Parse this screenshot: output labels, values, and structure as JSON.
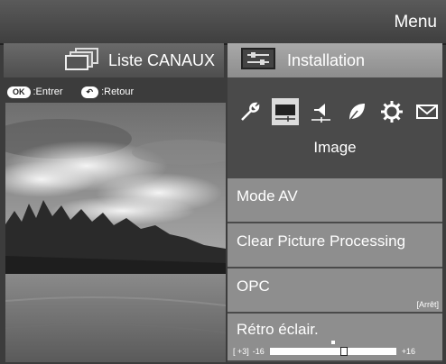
{
  "header": {
    "title": "Menu"
  },
  "tabs": {
    "left": {
      "label": "Liste CANAUX",
      "icon": "channel-list-icon"
    },
    "right": {
      "label": "Installation",
      "icon": "installation-icon"
    }
  },
  "hints": {
    "ok_key": "OK",
    "ok_text": ":Entrer",
    "return_key": "↶",
    "return_text": ":Retour"
  },
  "category_icons": [
    "wrench-icon",
    "picture-icon",
    "speaker-icon",
    "leaf-icon",
    "gear-icon",
    "envelope-icon"
  ],
  "selected_category": {
    "label": "Image",
    "index": 1
  },
  "items": [
    {
      "name": "Mode AV",
      "value": ""
    },
    {
      "name": "Clear Picture Processing",
      "value": ""
    },
    {
      "name": "OPC",
      "value": "[Arrêt]"
    },
    {
      "name": "Rétro éclair.",
      "current": "[  +3]",
      "min": "-16",
      "max": "+16",
      "level": 3
    }
  ],
  "colors": {
    "panel_bg": "#4a4a4a",
    "item_bg": "#8e8e8e",
    "active_tab": "#9c9c9c"
  }
}
